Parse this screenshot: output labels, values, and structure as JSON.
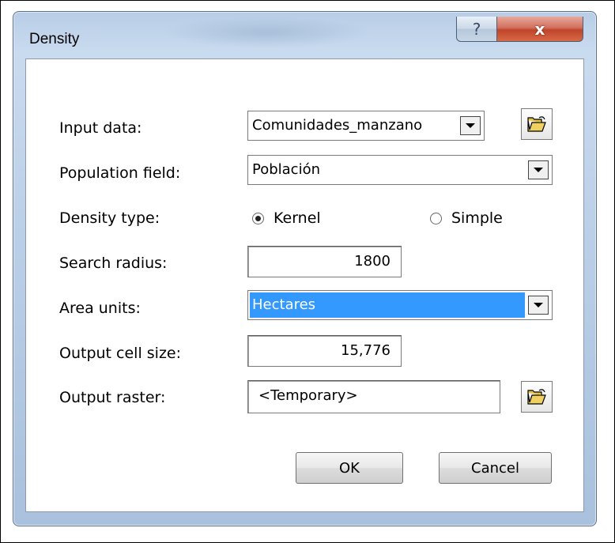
{
  "dialog": {
    "title": "Density",
    "help_glyph": "?",
    "close_glyph": "x"
  },
  "fields": {
    "input_data": {
      "label": "Input data:",
      "value": "Comunidades_manzano"
    },
    "population_field": {
      "label": "Population field:",
      "value": "Población"
    },
    "density_type": {
      "label": "Density type:",
      "options": [
        {
          "label": "Kernel",
          "selected": true
        },
        {
          "label": "Simple",
          "selected": false
        }
      ]
    },
    "search_radius": {
      "label": "Search radius:",
      "value": "1800"
    },
    "area_units": {
      "label": "Area units:",
      "value": "Hectares"
    },
    "output_cell_size": {
      "label": "Output cell size:",
      "value": "15,776"
    },
    "output_raster": {
      "label": "Output raster:",
      "value": "<Temporary>"
    }
  },
  "buttons": {
    "ok": "OK",
    "cancel": "Cancel"
  },
  "icons": {
    "browse": "folder-open-icon",
    "help": "help-icon",
    "close": "close-icon"
  },
  "colors": {
    "selection": "#3399ff",
    "close_button": "#c0442b",
    "title_bar": "#bcd0e8"
  }
}
